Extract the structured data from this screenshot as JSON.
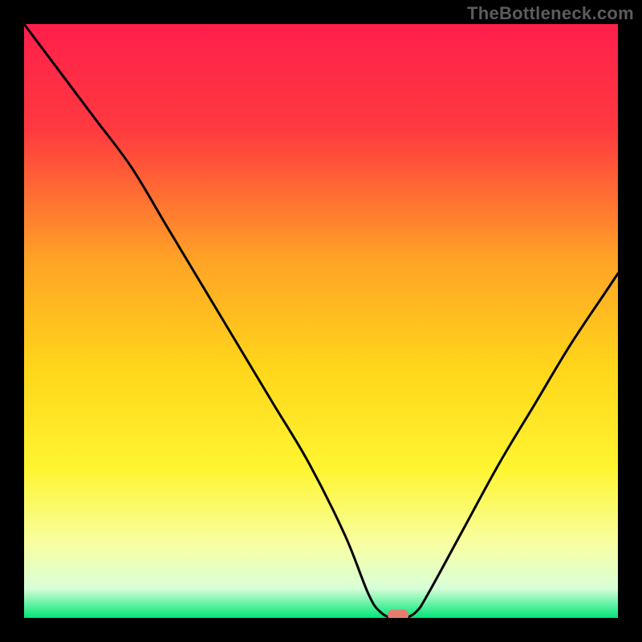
{
  "watermark": "TheBottleneck.com",
  "chart_data": {
    "type": "line",
    "title": "",
    "xlabel": "",
    "ylabel": "",
    "xlim": [
      0,
      100
    ],
    "ylim": [
      0,
      100
    ],
    "series": [
      {
        "name": "bottleneck-curve",
        "x": [
          0,
          6,
          12,
          18,
          24,
          30,
          36,
          42,
          48,
          54,
          58,
          60,
          62,
          64,
          66,
          68,
          74,
          80,
          86,
          92,
          98,
          100
        ],
        "values": [
          100,
          92,
          84,
          76,
          66,
          56,
          46,
          36,
          26,
          14,
          4,
          1,
          0,
          0,
          1,
          4,
          15,
          26,
          36,
          46,
          55,
          58
        ]
      }
    ],
    "minimum_marker": {
      "x": 63,
      "y": 0.5
    },
    "background_gradient": {
      "stops": [
        {
          "offset": 0.0,
          "color": "#ff1f4b"
        },
        {
          "offset": 0.18,
          "color": "#ff3a3f"
        },
        {
          "offset": 0.4,
          "color": "#ffa426"
        },
        {
          "offset": 0.58,
          "color": "#ffd61a"
        },
        {
          "offset": 0.75,
          "color": "#fff531"
        },
        {
          "offset": 0.88,
          "color": "#f7ffa6"
        },
        {
          "offset": 0.95,
          "color": "#d8ffd8"
        },
        {
          "offset": 1.0,
          "color": "#00e676"
        }
      ]
    },
    "marker_color": "#e87b6f"
  }
}
